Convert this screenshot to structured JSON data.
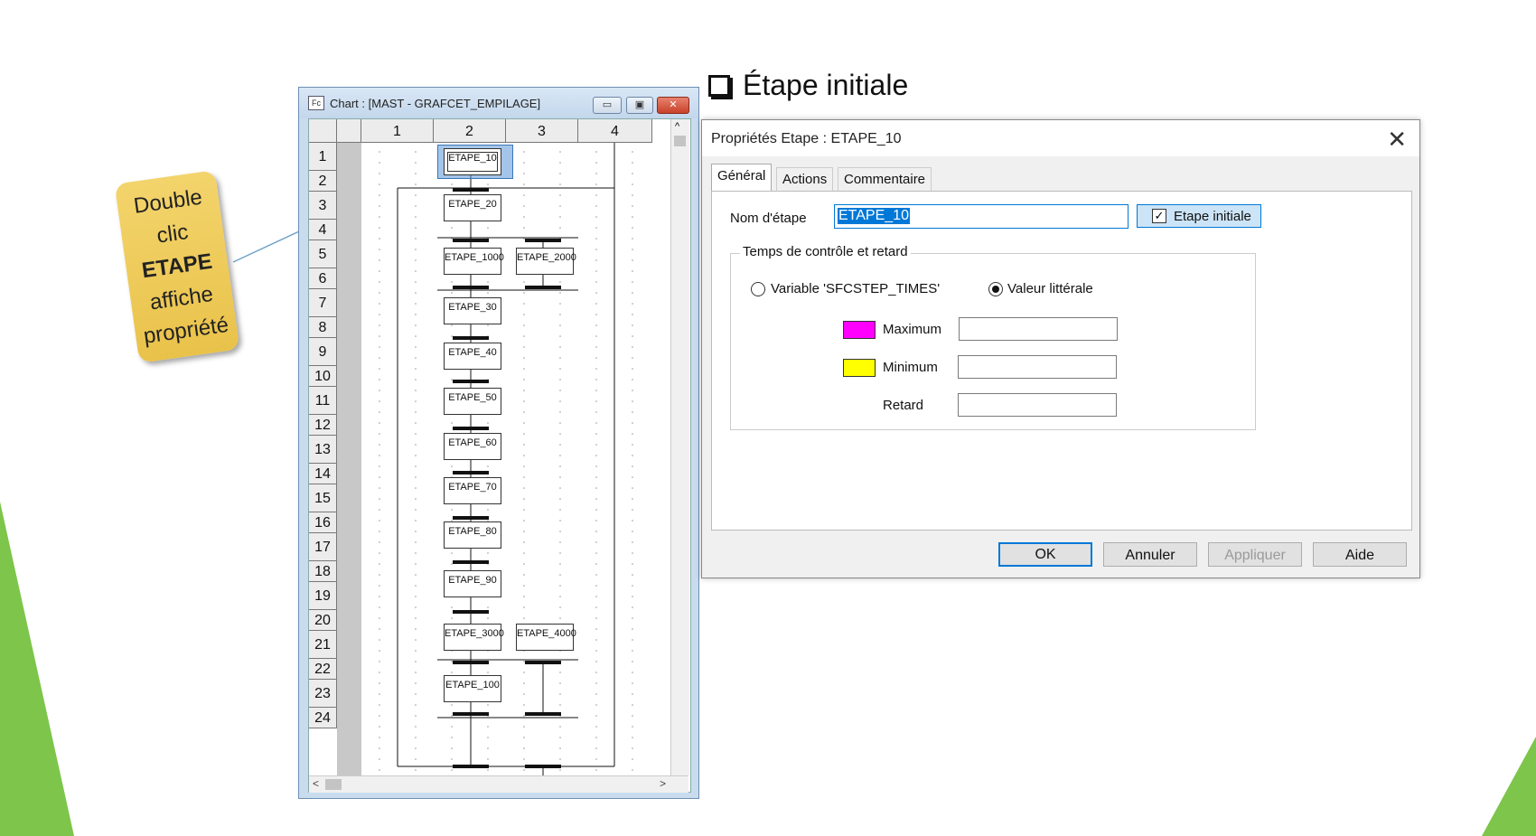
{
  "slide": {
    "heading": "Étape initiale",
    "note_lines": [
      "Double",
      "clic",
      "ETAPE",
      "affiche",
      "propriété"
    ],
    "accent_color": "#7dc54b"
  },
  "chart_window": {
    "title": "Chart : [MAST - GRAFCET_EMPILAGE]",
    "icon": "chart-app-icon",
    "columns": [
      "1",
      "2",
      "3",
      "4"
    ],
    "rows": [
      "1",
      "2",
      "3",
      "4",
      "5",
      "6",
      "7",
      "8",
      "9",
      "10",
      "11",
      "12",
      "13",
      "14",
      "15",
      "16",
      "17",
      "18",
      "19",
      "20",
      "21",
      "22",
      "23",
      "24"
    ],
    "steps": [
      "ETAPE_10",
      "ETAPE_20",
      "ETAPE_1000",
      "ETAPE_2000",
      "ETAPE_30",
      "ETAPE_40",
      "ETAPE_50",
      "ETAPE_60",
      "ETAPE_70",
      "ETAPE_80",
      "ETAPE_90",
      "ETAPE_3000",
      "ETAPE_4000",
      "ETAPE_100"
    ],
    "selected_step": "ETAPE_10"
  },
  "dialog": {
    "title": "Propriétés Etape : ETAPE_10",
    "close": "✕",
    "tabs": [
      "Général",
      "Actions",
      "Commentaire"
    ],
    "active_tab": "Général",
    "step_name_label": "Nom d'étape",
    "step_name_value": "ETAPE_10",
    "initial_step_label": "Etape initiale",
    "initial_step_checked": true,
    "group_title": "Temps de contrôle et retard",
    "radio_variable_label": "Variable 'SFCSTEP_TIMES'",
    "radio_literal_label": "Valeur littérale",
    "selected_radio": "Valeur littérale",
    "maximum_label": "Maximum",
    "maximum_color": "#ff00ff",
    "minimum_label": "Minimum",
    "minimum_color": "#ffff00",
    "delay_label": "Retard",
    "maximum_value": "",
    "minimum_value": "",
    "delay_value": "",
    "buttons": {
      "ok": "OK",
      "cancel": "Annuler",
      "apply": "Appliquer",
      "help": "Aide"
    }
  }
}
